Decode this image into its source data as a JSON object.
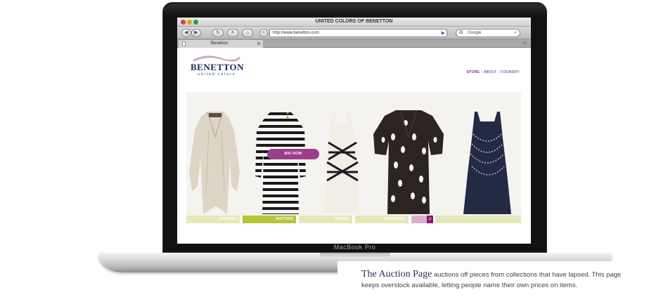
{
  "laptop": {
    "brand_label": "MacBook Pro"
  },
  "browser": {
    "window_title": "UNITED COLORS OF BENETTON",
    "address_value": "http://www.benetton.com",
    "search_placeholder": "Google",
    "tab_label": "Benetton"
  },
  "site": {
    "logo_word": "BENETTON",
    "logo_sub": "united colors",
    "nav": [
      {
        "label": "STORE",
        "active": true
      },
      {
        "label": "ABOUT",
        "active": false
      },
      {
        "label": "FOUNDRY",
        "active": false
      }
    ],
    "bid_button_label": "BID NOW",
    "collections": [
      {
        "label": "CURRENT",
        "color": "#e4e8b8"
      },
      {
        "label": "AUCTION",
        "color": "#b7c43a",
        "active": true
      },
      {
        "label": "SPRING",
        "color": "#e4e8b8"
      },
      {
        "label": "UPCOMING",
        "color": "#e4e8b8"
      }
    ],
    "next_label": ">",
    "accent_color": "#8c1a6a",
    "garments": [
      "cream-drape-cardigan",
      "striped-knit-dress",
      "cross-strap-tank-dress",
      "cutout-knit-cardigan",
      "beaded-navy-dress"
    ]
  },
  "caption": {
    "title": "The Auction Page",
    "line1": " auctions off pieces from collections that have lapsed. This page",
    "line2": "keeps overstock available, letting people name their own prices on items."
  }
}
